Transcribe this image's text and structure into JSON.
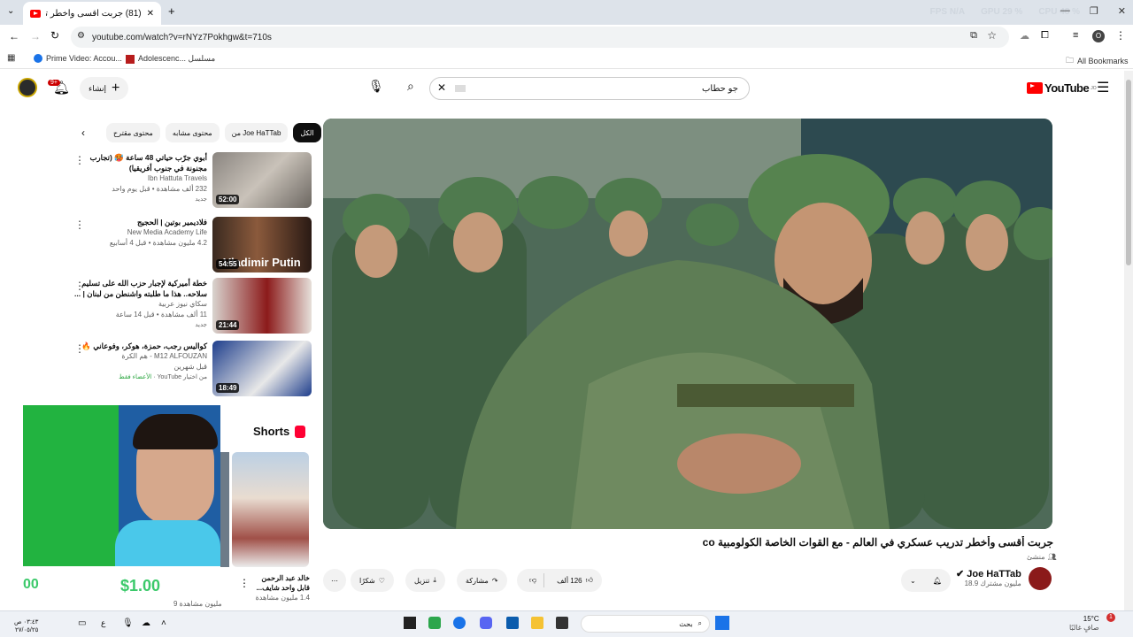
{
  "browser": {
    "tab_title": "(81) جربت أقسى وأخطر تدري...",
    "url": "youtube.com/watch?v=rNYz7Pokhgw&t=710s",
    "stats": [
      "FPS N/A",
      "GPU 29 %",
      "CPU 48 %"
    ],
    "bookmarks": [
      "Prime Video: Accou...",
      "Adolescenc... مسلسل"
    ],
    "all_bookmarks": "All Bookmarks",
    "profile_letter": "O"
  },
  "youtube": {
    "logo": "YouTube",
    "logo_sup": "JO",
    "search_query": "جو حطاب",
    "create_label": "إنشاء",
    "notification_count": "9+",
    "chips": [
      "محتوى مقترح",
      "محتوى مشابه",
      "من Joe HaTTab",
      "الكل"
    ],
    "recommendations": [
      {
        "title": "أبوي جرّب حياتي 48 ساعة 🥵 (تجارب مجنونة في جنوب أفريقيا)",
        "channel": "Ibn Hattuta Travels",
        "meta": "232 ألف مشاهدة • قبل يوم واحد",
        "badge": "جديد",
        "duration": "52:00"
      },
      {
        "title": "فلاديمير بوتين | الحجيج",
        "channel": "New Media Academy Life",
        "meta": "4.2 مليون مشاهدة • قبل 4 أسابيع",
        "badge": "",
        "duration": "54:55",
        "thumb_text": "Vladimir Putin"
      },
      {
        "title": "خطة أميركية لإجبار حزب الله على تسليم سلاحه.. هذا ما طلبته واشنطن من لبنان | ...",
        "channel": "سكاي نيوز عربية",
        "meta": "11 ألف مشاهدة • قبل 14 ساعة",
        "badge": "جديد",
        "duration": "21:44"
      },
      {
        "title": "كواليس رجب، حمزة، هوكر، وفوعاني 🔥",
        "channel": "M12 ALFOUZAN - هم الكرة",
        "meta": "قبل شهرين",
        "badge": "الأعضاء فقط",
        "badge2": "من اختيار YouTube",
        "duration": "18:49"
      }
    ],
    "shorts_label": "Shorts",
    "shorts": [
      {
        "title": "خالد عبد الرحمن قابل واحد شايف...",
        "views": "1.4 مليون مشاهدة"
      },
      {
        "title": "...",
        "views": "9 مليون مشاهدة"
      }
    ],
    "video": {
      "title": "جربت أقسى وأخطر تدريب عسكري في العالم - مع القوات الخاصة الكولومبية co",
      "channel": "Joe HaTTab",
      "subscribers": "18.9 مليون مشترك",
      "like_count": "126 ألف",
      "share_label": "مشاركة",
      "download_label": "تنزيل",
      "thanks_label": "شكرًا",
      "member_label": "منشئ"
    }
  },
  "overlay": {
    "left_counter": "00",
    "money": "$1.00"
  },
  "taskbar": {
    "search_placeholder": "بحث",
    "weather": "15°C",
    "weather_desc": "صافٍ غالبًا",
    "time": "٠٣:٤٣ ص",
    "date": "٢٧/٠٥/٢٥",
    "badge": "1"
  }
}
